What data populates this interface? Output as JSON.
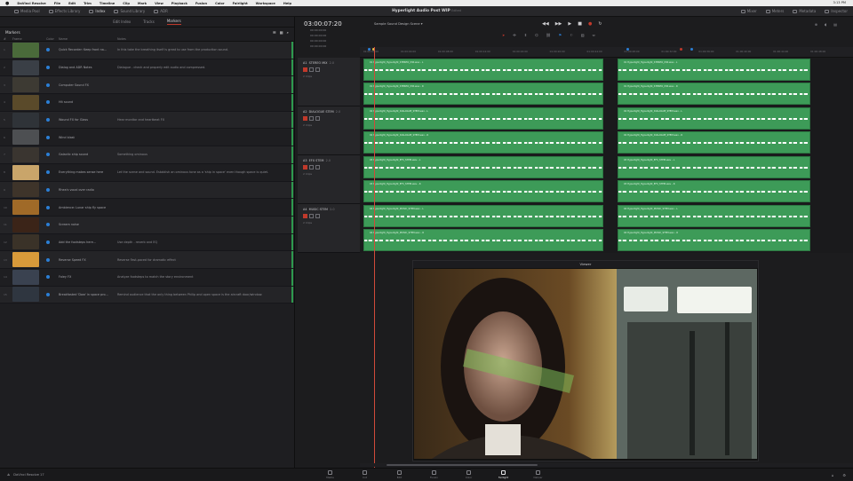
{
  "menubar": {
    "app": "DaVinci Resolve",
    "items": [
      "File",
      "Edit",
      "Trim",
      "Timeline",
      "Clip",
      "Mark",
      "View",
      "Playback",
      "Fusion",
      "Color",
      "Fairlight",
      "Workspace",
      "Help"
    ],
    "clock": "3:13 PM"
  },
  "toolbar": {
    "left": [
      "Media Pool",
      "Effects Library",
      "Index",
      "Sound Library",
      "ADR"
    ],
    "project_title": "Hyperlight Audio Post WIP",
    "project_status": "Edited",
    "right": [
      "Mixer",
      "Meters",
      "Metadata",
      "Inspector"
    ]
  },
  "left_pane": {
    "tabs": [
      "Edit Index",
      "Tracks",
      "Markers"
    ],
    "active_tab": "Markers",
    "title": "Markers",
    "columns": [
      "#",
      "Frame",
      "Color",
      "Name",
      "Notes"
    ],
    "rows": [
      {
        "num": "1",
        "name": "Quick Recorder: Keep front na...",
        "notes": "In this take the breathing itself is great to use from the production sound.",
        "thumb": "#4a6a3a"
      },
      {
        "num": "2",
        "name": "Dialog and ADR Notes",
        "notes": "Dialogue - check and properly edit audio and compressed.",
        "thumb": "#3a3f46"
      },
      {
        "num": "3",
        "name": "Computer Sound FX",
        "notes": "",
        "thumb": "#3d3a33"
      },
      {
        "num": "4",
        "name": "Hit sound",
        "notes": "",
        "thumb": "#5a4a2a"
      },
      {
        "num": "5",
        "name": "Wound FX for Glass",
        "notes": "Hear monitor and heartbeat FX",
        "thumb": "#2f3338"
      },
      {
        "num": "6",
        "name": "Wind blast",
        "notes": "",
        "thumb": "#4d4f52"
      },
      {
        "num": "7",
        "name": "Galactic ship sound",
        "notes": "Something ominous",
        "thumb": "#3a3530"
      },
      {
        "num": "8",
        "name": "Everything makes sense here",
        "notes": "Let the scene and sound. Establish an ominous tone as a 'ship in space' even though space is quiet.",
        "thumb": "#c9a56a"
      },
      {
        "num": "9",
        "name": "Rhea's vocal over radio",
        "notes": "",
        "thumb": "#3e342a"
      },
      {
        "num": "10",
        "name": "Ambience: Lunar ship fly space",
        "notes": "",
        "thumb": "#a06a28"
      },
      {
        "num": "11",
        "name": "Scream noise",
        "notes": "",
        "thumb": "#3b2418"
      },
      {
        "num": "12",
        "name": "Add the footsteps here...",
        "notes": "Use depth - reverb and EQ",
        "thumb": "#3a3228"
      },
      {
        "num": "13",
        "name": "Reverse Speed FX",
        "notes": "Reverse Fast-paced for dramatic effect",
        "thumb": "#d89a3a"
      },
      {
        "num": "14",
        "name": "Foley FX",
        "notes": "Analyze footsteps to match the story environment",
        "thumb": "#3a4250"
      },
      {
        "num": "15",
        "name": "Breakfasted 'Daw' in space pro...",
        "notes": "Remind audience that the only thing between Philip and open space is the aircraft door/window.",
        "thumb": "#2f3640"
      }
    ]
  },
  "timeline": {
    "timecode": "03:00:07:20",
    "sub_timecodes": [
      "00:00:00:00",
      "00:00:00:00",
      "00:00:00:00",
      "00:00:00:00"
    ],
    "name": "Sample Sound Design Scene",
    "ruler_ticks": [
      "01:00:00:00",
      "01:00:04:00",
      "01:00:08:00",
      "01:00:12:00",
      "01:00:16:00",
      "01:00:20:00",
      "01:00:24:00",
      "01:00:28:00",
      "01:00:32:00",
      "01:00:36:00",
      "01:00:40:00",
      "01:00:44:00",
      "01:00:48:00"
    ],
    "marker_colors": [
      "#2b7fd6",
      "#e0c04a",
      "#2b7fd6",
      "#c0392b",
      "#2b7fd6"
    ],
    "tracks": [
      {
        "id": "A1",
        "name": "STEREO MIX",
        "level": "2.0",
        "clips": "2 Clips"
      },
      {
        "id": "A2",
        "name": "DIALOGUE STEM",
        "level": "2.0",
        "clips": "2 Clips"
      },
      {
        "id": "A3",
        "name": "EFX STEM",
        "level": "2.0",
        "clips": "2 Clips"
      },
      {
        "id": "A4",
        "name": "MUSIC STEM",
        "level": "2.0",
        "clips": "2 Clips"
      }
    ],
    "clip_names": [
      "01 Hyperlight_Hyperlight_STEREO_MIX.wav - L",
      "01 Hyperlight_Hyperlight_STEREO_MIX.wav - R",
      "02 Hyperlight_Hyperlight_DIALOGUE_STEM.wav - L",
      "02 Hyperlight_Hyperlight_DIALOGUE_STEM.wav - R",
      "03 Hyperlight_Hyperlight_EFX_STEM.wav - L",
      "03 Hyperlight_Hyperlight_EFX_STEM.wav - R",
      "04 Hyperlight_Hyperlight_MUSIC_STEM.wav - L",
      "04 Hyperlight_Hyperlight_MUSIC_STEM.wav - R"
    ]
  },
  "viewer": {
    "title": "Viewer"
  },
  "pages": {
    "items": [
      "Media",
      "Cut",
      "Edit",
      "Fusion",
      "Color",
      "Fairlight",
      "Deliver"
    ],
    "active": "Fairlight"
  },
  "brand": "DaVinci Resolve 17",
  "colors": {
    "accent_red": "#c0392b",
    "clip_green": "#3d9b58",
    "marker_blue": "#2b7fd6",
    "playhead": "#d14a3a"
  }
}
